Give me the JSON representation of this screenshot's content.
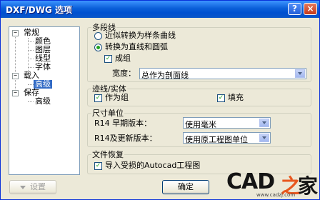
{
  "window": {
    "title": "DXF/DWG 选项",
    "help_icon": "?",
    "close_icon": "×"
  },
  "tree": {
    "groups": [
      {
        "label": "常规",
        "items": [
          "颜色",
          "图层",
          "线型",
          "字体"
        ]
      },
      {
        "label": "载入",
        "items": [
          "高级"
        ]
      },
      {
        "label": "保存",
        "items": [
          "高级"
        ]
      }
    ],
    "selected": "载入 / 高级"
  },
  "polyline": {
    "legend": "多段线",
    "radio_spline": "近似转换为样条曲线",
    "radio_lines_arcs": "转换为直线和圆弧",
    "radio_selected": "转换为直线和圆弧",
    "group_label": "成组",
    "group_checked": true,
    "width_label": "宽度：",
    "width_value": "总作为剖面线"
  },
  "trace": {
    "legend": "迹线/实体",
    "as_group_label": "作为组",
    "as_group_checked": true,
    "fill_label": "填充",
    "fill_checked": true
  },
  "units": {
    "legend": "尺寸单位",
    "r14_early_label": "R14 早期版本：",
    "r14_early_value": "使用毫米",
    "r14_later_label": "R14及更新版本：",
    "r14_later_value": "使用原工程图单位"
  },
  "recovery": {
    "legend": "文件恢复",
    "import_damaged_label": "导入受损的Autocad工程图",
    "import_damaged_checked": true
  },
  "buttons": {
    "settings": "设置",
    "ok": "确定"
  },
  "watermark": {
    "logo_cad": "CAD",
    "logo_zhi": "之",
    "logo_jia": "家",
    "url": "www.cadzj.com"
  },
  "colors": {
    "titlebar": "#0a5fd8",
    "dialog_bg": "#ece9d8",
    "selection": "#316ac5"
  }
}
